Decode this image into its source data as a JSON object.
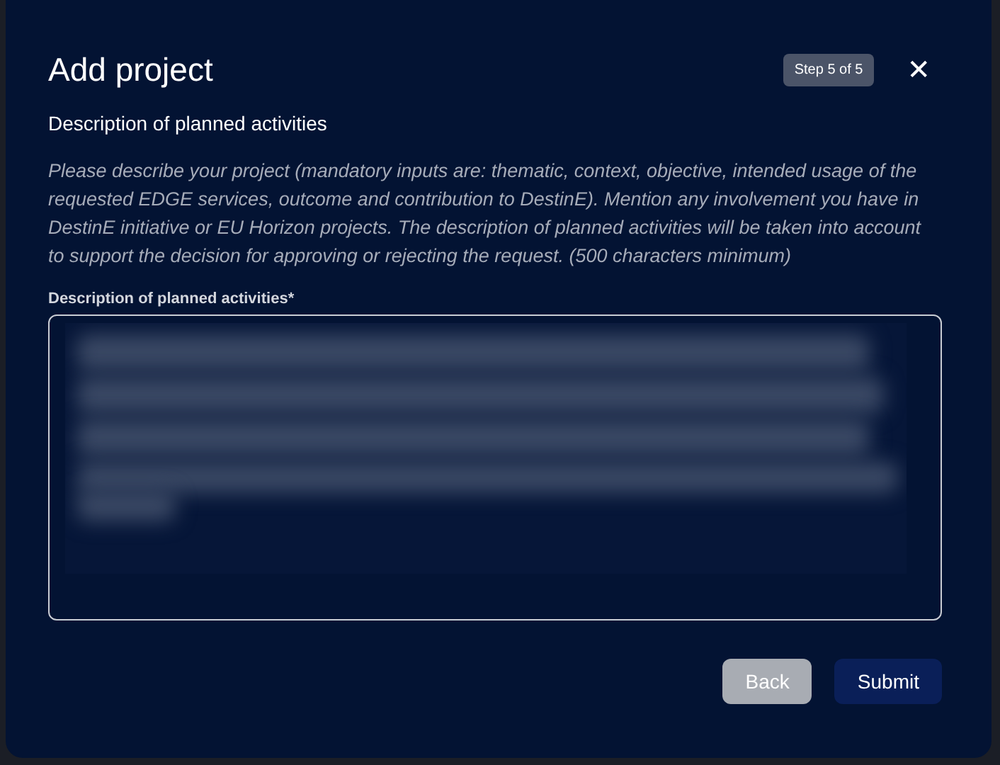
{
  "dialog": {
    "title": "Add project",
    "step_badge": "Step 5 of 5",
    "close": "✕"
  },
  "section": {
    "title": "Description of planned activities",
    "hint": "Please describe your project (mandatory inputs are: thematic, context, objective, intended usage of the requested EDGE services, outcome and contribution to DestinE). Mention any involvement you have in DestinE initiative or EU Horizon projects. The description of planned activities will be taken into account to support the decision for approving or rejecting the request. (500 characters minimum)"
  },
  "field": {
    "label": "Description of planned activities*",
    "content": {
      "kind": "blurred"
    }
  },
  "buttons": [
    {
      "label": "Back",
      "kind": "secondary"
    },
    {
      "label": "Submit",
      "kind": "primary"
    }
  ]
}
